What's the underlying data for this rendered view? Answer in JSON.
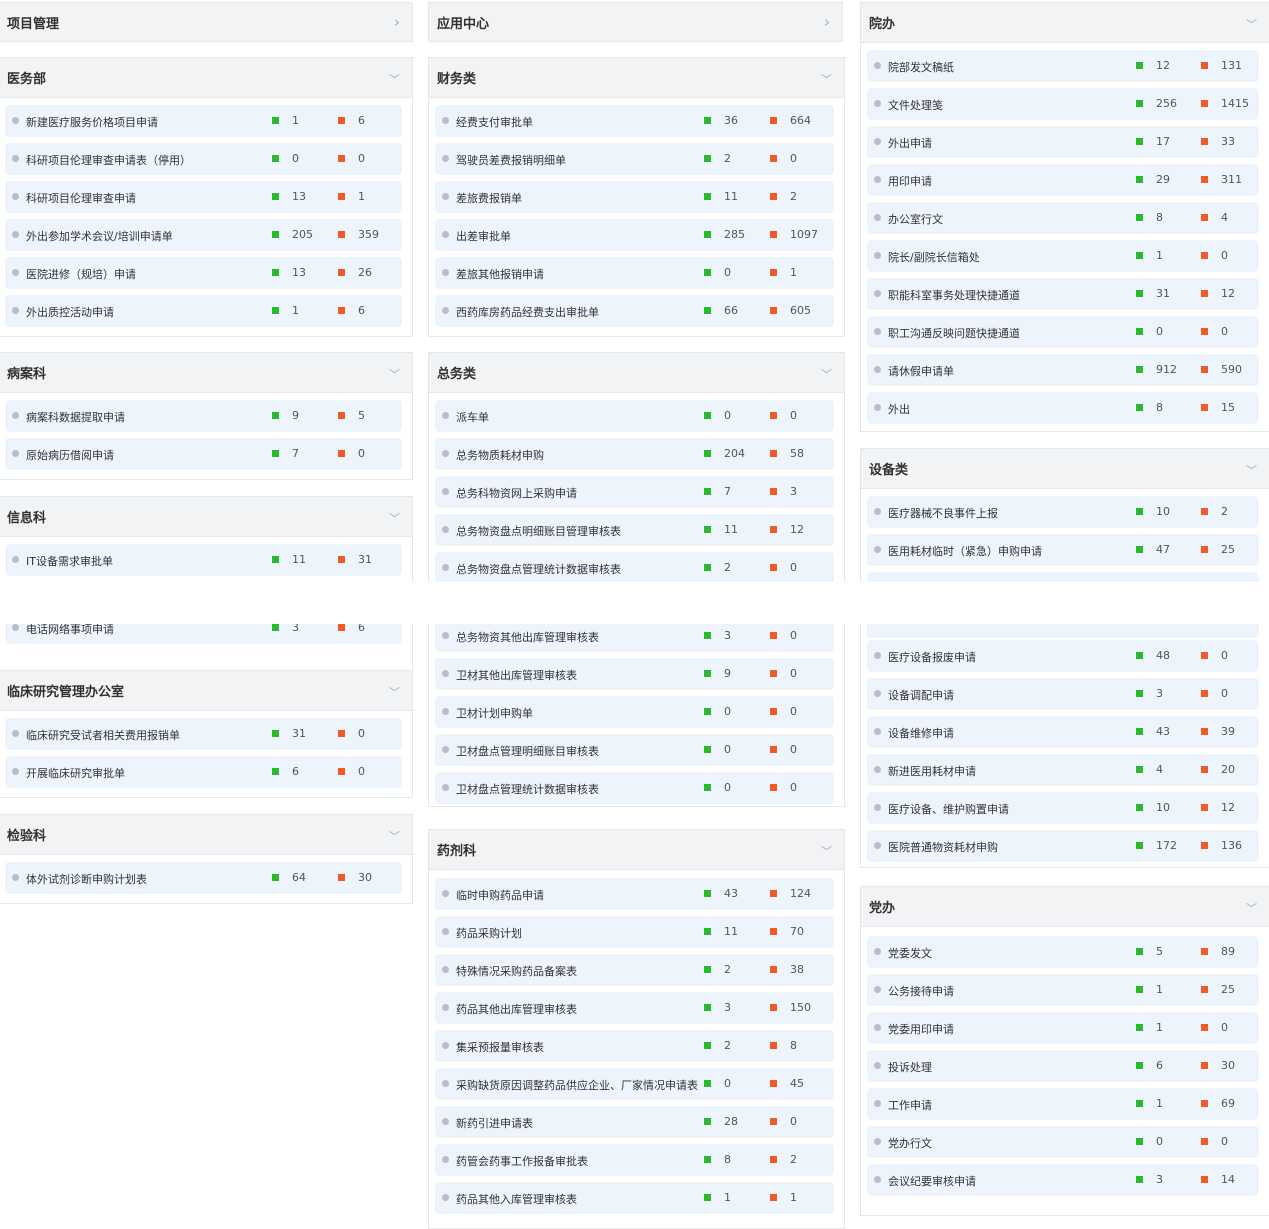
{
  "top_panels": [
    {
      "title": "项目管理"
    },
    {
      "title": "应用中心"
    }
  ],
  "col1": [
    {
      "title": "医务部",
      "rows": [
        {
          "label": "新建医疗服务价格项目申请",
          "g": "1",
          "r": "6"
        },
        {
          "label": "科研项目伦理审查申请表（停用）",
          "g": "0",
          "r": "0"
        },
        {
          "label": "科研项目伦理审查申请",
          "g": "13",
          "r": "1"
        },
        {
          "label": "外出参加学术会议/培训申请单",
          "g": "205",
          "r": "359"
        },
        {
          "label": "医院进修（规培）申请",
          "g": "13",
          "r": "26"
        },
        {
          "label": "外出质控活动申请",
          "g": "1",
          "r": "6"
        }
      ]
    },
    {
      "title": "病案科",
      "rows": [
        {
          "label": "病案科数据提取申请",
          "g": "9",
          "r": "5"
        },
        {
          "label": "原始病历借阅申请",
          "g": "7",
          "r": "0"
        }
      ]
    },
    {
      "title": "信息科",
      "rows": [
        {
          "label": "IT设备需求审批单",
          "g": "11",
          "r": "31"
        },
        {
          "label": "电话网络事项申请",
          "g": "3",
          "r": "6"
        }
      ]
    },
    {
      "title": "临床研究管理办公室",
      "rows": [
        {
          "label": "临床研究受试者相关费用报销单",
          "g": "31",
          "r": "0"
        },
        {
          "label": "开展临床研究审批单",
          "g": "6",
          "r": "0"
        }
      ]
    },
    {
      "title": "检验科",
      "rows": [
        {
          "label": "体外试剂诊断申购计划表",
          "g": "64",
          "r": "30"
        }
      ]
    }
  ],
  "col2": [
    {
      "title": "财务类",
      "rows": [
        {
          "label": "经费支付审批单",
          "g": "36",
          "r": "664"
        },
        {
          "label": "驾驶员差费报销明细单",
          "g": "2",
          "r": "0"
        },
        {
          "label": "差旅费报销单",
          "g": "11",
          "r": "2"
        },
        {
          "label": "出差审批单",
          "g": "285",
          "r": "1097"
        },
        {
          "label": "差旅其他报销申请",
          "g": "0",
          "r": "1"
        },
        {
          "label": "西药库房药品经费支出审批单",
          "g": "66",
          "r": "605"
        }
      ]
    },
    {
      "title": "总务类",
      "rows": [
        {
          "label": "派车单",
          "g": "0",
          "r": "0"
        },
        {
          "label": "总务物质耗材申购",
          "g": "204",
          "r": "58"
        },
        {
          "label": "总务科物资网上采购申请",
          "g": "7",
          "r": "3"
        },
        {
          "label": "总务物资盘点明细账目管理审核表",
          "g": "11",
          "r": "12"
        },
        {
          "label": "总务物资盘点管理统计数据审核表",
          "g": "2",
          "r": "0"
        },
        {
          "label": "总务物资其他出库管理审核表",
          "g": "3",
          "r": "0"
        },
        {
          "label": "卫材其他出库管理审核表",
          "g": "9",
          "r": "0"
        },
        {
          "label": "卫材计划申购单",
          "g": "0",
          "r": "0"
        },
        {
          "label": "卫材盘点管理明细账目审核表",
          "g": "0",
          "r": "0"
        },
        {
          "label": "卫材盘点管理统计数据审核表",
          "g": "0",
          "r": "0"
        }
      ]
    },
    {
      "title": "药剂科",
      "rows": [
        {
          "label": "临时申购药品申请",
          "g": "43",
          "r": "124"
        },
        {
          "label": "药品采购计划",
          "g": "11",
          "r": "70"
        },
        {
          "label": "特殊情况采购药品备案表",
          "g": "2",
          "r": "38"
        },
        {
          "label": "药品其他出库管理审核表",
          "g": "3",
          "r": "150"
        },
        {
          "label": "集采预报量审核表",
          "g": "2",
          "r": "8"
        },
        {
          "label": "采购缺货原因调整药品供应企业、厂家情况申请表",
          "g": "0",
          "r": "45"
        },
        {
          "label": "新药引进申请表",
          "g": "28",
          "r": "0"
        },
        {
          "label": "药管会药事工作报备审批表",
          "g": "8",
          "r": "2"
        },
        {
          "label": "药品其他入库管理审核表",
          "g": "1",
          "r": "1"
        }
      ]
    }
  ],
  "col3": [
    {
      "title": "院办",
      "rows": [
        {
          "label": "院部发文稿纸",
          "g": "12",
          "r": "131"
        },
        {
          "label": "文件处理笺",
          "g": "256",
          "r": "1415"
        },
        {
          "label": "外出申请",
          "g": "17",
          "r": "33"
        },
        {
          "label": "用印申请",
          "g": "29",
          "r": "311"
        },
        {
          "label": "办公室行文",
          "g": "8",
          "r": "4"
        },
        {
          "label": "院长/副院长信箱处",
          "g": "1",
          "r": "0"
        },
        {
          "label": "职能科室事务处理快捷通道",
          "g": "31",
          "r": "12"
        },
        {
          "label": "职工沟通反映问题快捷通道",
          "g": "0",
          "r": "0"
        },
        {
          "label": "请休假申请单",
          "g": "912",
          "r": "590"
        },
        {
          "label": "外出",
          "g": "8",
          "r": "15"
        }
      ]
    },
    {
      "title": "设备类",
      "rows": [
        {
          "label": "医疗器械不良事件上报",
          "g": "10",
          "r": "2"
        },
        {
          "label": "医用耗材临时（紧急）申购申请",
          "g": "47",
          "r": "25"
        },
        {
          "label": "",
          "g": "",
          "r": ""
        },
        {
          "label": "",
          "g": "",
          "r": ""
        },
        {
          "label": "医疗设备报废申请",
          "g": "48",
          "r": "0"
        },
        {
          "label": "设备调配申请",
          "g": "3",
          "r": "0"
        },
        {
          "label": "设备维修申请",
          "g": "43",
          "r": "39"
        },
        {
          "label": "新进医用耗材申请",
          "g": "4",
          "r": "20"
        },
        {
          "label": "医疗设备、维护购置申请",
          "g": "10",
          "r": "12"
        },
        {
          "label": "医院普通物资耗材申购",
          "g": "172",
          "r": "136"
        }
      ]
    },
    {
      "title": "党办",
      "rows": [
        {
          "label": "党委发文",
          "g": "5",
          "r": "89"
        },
        {
          "label": "公务接待申请",
          "g": "1",
          "r": "25"
        },
        {
          "label": "党委用印申请",
          "g": "1",
          "r": "0"
        },
        {
          "label": "投诉处理",
          "g": "6",
          "r": "30"
        },
        {
          "label": "工作申请",
          "g": "1",
          "r": "69"
        },
        {
          "label": "党办行文",
          "g": "0",
          "r": "0"
        },
        {
          "label": "会议纪要审核申请",
          "g": "3",
          "r": "14"
        }
      ]
    }
  ],
  "colors": {
    "green": "#2eb82e",
    "red": "#ee5a2a",
    "row_bg": "#eef4fb",
    "header_bg": "#f1f3f5"
  }
}
